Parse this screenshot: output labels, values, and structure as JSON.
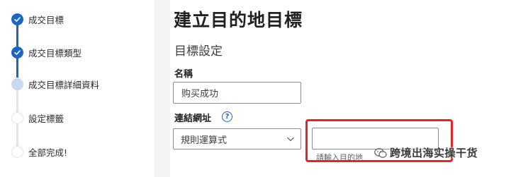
{
  "stepper": {
    "steps": [
      {
        "label": "成交目標",
        "state": "done"
      },
      {
        "label": "成交目標類型",
        "state": "done"
      },
      {
        "label": "成交目標詳細資料",
        "state": "current"
      },
      {
        "label": "設定標籤",
        "state": "todo"
      },
      {
        "label": "全部完成!",
        "state": "todo"
      }
    ]
  },
  "main": {
    "title": "建立目的地目標",
    "section_title": "目標設定",
    "name_label": "名稱",
    "name_value": "购买成功",
    "url_label": "連結網址",
    "help_glyph": "?",
    "match_select_value": "規則運算式",
    "url_input_value": "",
    "url_placeholder": "請輸入目的地"
  },
  "watermark": {
    "text": "跨境出海实操干货"
  },
  "colors": {
    "accent": "#1a66c2",
    "highlight": "#e02626",
    "step_current": "#c9d9ef"
  }
}
